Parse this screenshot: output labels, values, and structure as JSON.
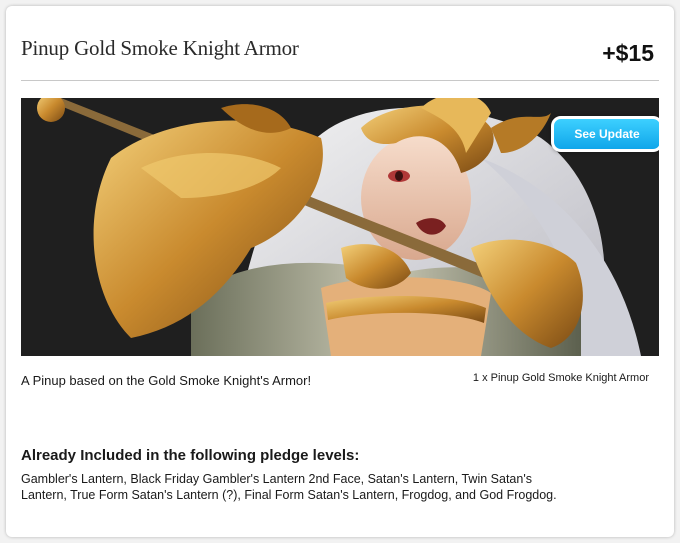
{
  "reward": {
    "title": "Pinup Gold Smoke Knight Armor",
    "price": "+$15",
    "image_alt": "Pinup artwork of a knight in gold armor",
    "see_update_label": "See Update",
    "description": "A Pinup based on the Gold Smoke Knight's Armor!",
    "quantity_line": "1 x Pinup Gold Smoke Knight Armor"
  },
  "included": {
    "heading": "Already Included in the following pledge levels:",
    "text": "Gambler's Lantern, Black Friday Gambler's Lantern 2nd Face, Satan's Lantern, Twin Satan's Lantern, True Form Satan's Lantern (?), Final Form Satan's Lantern, Frogdog, and God Frogdog."
  },
  "colors": {
    "button_top": "#3dd0ff",
    "button_bottom": "#10a6ea",
    "art_background": "#1f1f1f",
    "gold": "#c98a2e"
  }
}
